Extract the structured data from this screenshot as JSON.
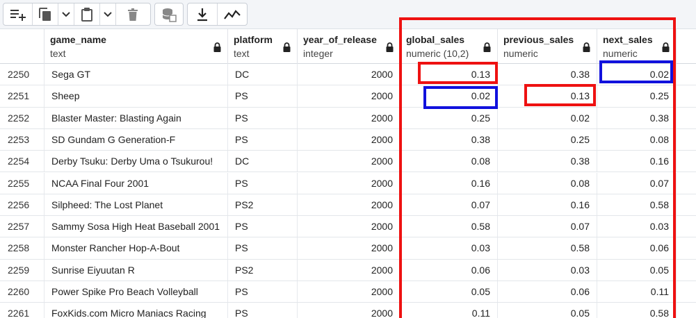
{
  "toolbar": {
    "buttons": [
      {
        "name": "add-row-button",
        "icon": "add-row-icon"
      },
      {
        "name": "copy-button",
        "icon": "copy-icon"
      },
      {
        "name": "copy-options-dropdown",
        "icon": "chevron-down-icon"
      },
      {
        "name": "paste-button",
        "icon": "paste-icon"
      },
      {
        "name": "paste-options-dropdown",
        "icon": "chevron-down-icon"
      },
      {
        "name": "delete-button",
        "icon": "trash-icon"
      },
      {
        "name": "save-data-button",
        "icon": "database-save-icon"
      },
      {
        "name": "download-button",
        "icon": "download-icon"
      },
      {
        "name": "graph-button",
        "icon": "line-graph-icon"
      }
    ]
  },
  "columns": [
    {
      "name": "game_name",
      "type": "text"
    },
    {
      "name": "platform",
      "type": "text"
    },
    {
      "name": "year_of_release",
      "type": "integer"
    },
    {
      "name": "global_sales",
      "type": "numeric (10,2)"
    },
    {
      "name": "previous_sales",
      "type": "numeric"
    },
    {
      "name": "next_sales",
      "type": "numeric"
    }
  ],
  "rows": [
    {
      "n": "2250",
      "game": "Sega GT",
      "platform": "DC",
      "year": "2000",
      "gs": "0.13",
      "ps": "0.38",
      "ns": "0.02"
    },
    {
      "n": "2251",
      "game": "Sheep",
      "platform": "PS",
      "year": "2000",
      "gs": "0.02",
      "ps": "0.13",
      "ns": "0.25"
    },
    {
      "n": "2252",
      "game": "Blaster Master: Blasting Again",
      "platform": "PS",
      "year": "2000",
      "gs": "0.25",
      "ps": "0.02",
      "ns": "0.38"
    },
    {
      "n": "2253",
      "game": "SD Gundam G Generation-F",
      "platform": "PS",
      "year": "2000",
      "gs": "0.38",
      "ps": "0.25",
      "ns": "0.08"
    },
    {
      "n": "2254",
      "game": "Derby Tsuku: Derby Uma o Tsukurou!",
      "platform": "DC",
      "year": "2000",
      "gs": "0.08",
      "ps": "0.38",
      "ns": "0.16"
    },
    {
      "n": "2255",
      "game": "NCAA Final Four 2001",
      "platform": "PS",
      "year": "2000",
      "gs": "0.16",
      "ps": "0.08",
      "ns": "0.07"
    },
    {
      "n": "2256",
      "game": "Silpheed: The Lost Planet",
      "platform": "PS2",
      "year": "2000",
      "gs": "0.07",
      "ps": "0.16",
      "ns": "0.58"
    },
    {
      "n": "2257",
      "game": "Sammy Sosa High Heat Baseball 2001",
      "platform": "PS",
      "year": "2000",
      "gs": "0.58",
      "ps": "0.07",
      "ns": "0.03"
    },
    {
      "n": "2258",
      "game": "Monster Rancher Hop-A-Bout",
      "platform": "PS",
      "year": "2000",
      "gs": "0.03",
      "ps": "0.58",
      "ns": "0.06"
    },
    {
      "n": "2259",
      "game": "Sunrise Eiyuutan R",
      "platform": "PS2",
      "year": "2000",
      "gs": "0.06",
      "ps": "0.03",
      "ns": "0.05"
    },
    {
      "n": "2260",
      "game": "Power Spike Pro Beach Volleyball",
      "platform": "PS",
      "year": "2000",
      "gs": "0.05",
      "ps": "0.06",
      "ns": "0.11"
    },
    {
      "n": "2261",
      "game": "FoxKids.com Micro Maniacs Racing",
      "platform": "PS",
      "year": "2000",
      "gs": "0.11",
      "ps": "0.05",
      "ns": "0.58"
    }
  ],
  "annotation_colors": {
    "red": "#ee1111",
    "blue": "#1111dd"
  }
}
